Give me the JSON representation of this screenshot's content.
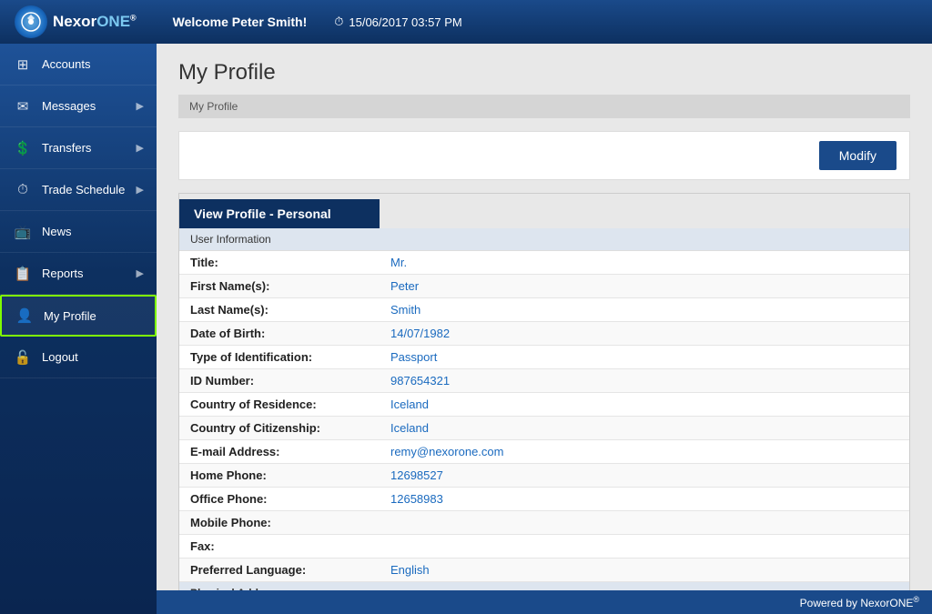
{
  "header": {
    "welcome": "Welcome Peter Smith!",
    "datetime": "15/06/2017 03:57 PM",
    "logo_text_nexor": "Nexor",
    "logo_text_one": "ONE",
    "logo_sup": "®"
  },
  "sidebar": {
    "items": [
      {
        "id": "accounts",
        "label": "Accounts",
        "icon": "⊞",
        "hasArrow": false
      },
      {
        "id": "messages",
        "label": "Messages",
        "icon": "◀",
        "hasArrow": true
      },
      {
        "id": "transfers",
        "label": "Transfers",
        "icon": "$",
        "hasArrow": true
      },
      {
        "id": "trade-schedule",
        "label": "Trade Schedule",
        "icon": "⏱",
        "hasArrow": true
      },
      {
        "id": "news",
        "label": "News",
        "icon": "📺",
        "hasArrow": false
      },
      {
        "id": "reports",
        "label": "Reports",
        "icon": "📋",
        "hasArrow": true
      },
      {
        "id": "my-profile",
        "label": "My Profile",
        "icon": "👤",
        "hasArrow": false,
        "active": true
      },
      {
        "id": "logout",
        "label": "Logout",
        "icon": "🔒",
        "hasArrow": false
      }
    ]
  },
  "page": {
    "title": "My Profile",
    "breadcrumb": "My Profile",
    "modify_button": "Modify",
    "section_title": "View Profile - Personal"
  },
  "profile": {
    "section_label": "User Information",
    "fields": [
      {
        "label": "Title:",
        "value": "Mr."
      },
      {
        "label": "First Name(s):",
        "value": "Peter"
      },
      {
        "label": "Last Name(s):",
        "value": "Smith"
      },
      {
        "label": "Date of Birth:",
        "value": "14/07/1982"
      },
      {
        "label": "Type of Identification:",
        "value": "Passport"
      },
      {
        "label": "ID Number:",
        "value": "987654321"
      },
      {
        "label": "Country of Residence:",
        "value": "Iceland"
      },
      {
        "label": "Country of Citizenship:",
        "value": "Iceland"
      },
      {
        "label": "E-mail Address:",
        "value": "remy@nexorone.com"
      },
      {
        "label": "Home Phone:",
        "value": "12698527"
      },
      {
        "label": "Office Phone:",
        "value": "12658983"
      },
      {
        "label": "Mobile Phone:",
        "value": ""
      },
      {
        "label": "Fax:",
        "value": ""
      },
      {
        "label": "Preferred Language:",
        "value": "English"
      },
      {
        "label": "Physical Address",
        "value": ""
      }
    ]
  },
  "footer": {
    "text": "Powered by NexorONE"
  }
}
